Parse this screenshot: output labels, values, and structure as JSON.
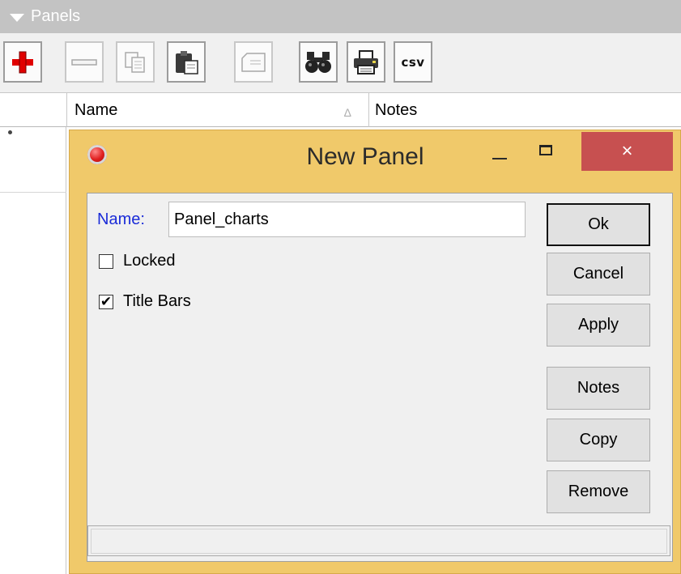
{
  "panels_header": {
    "title": "Panels"
  },
  "toolbar": {
    "buttons": [
      {
        "icon": "add-icon",
        "enabled": true
      },
      {
        "icon": "remove-icon",
        "enabled": false
      },
      {
        "icon": "copy-icon",
        "enabled": false
      },
      {
        "icon": "paste-icon",
        "enabled": true
      },
      {
        "icon": "comment-icon",
        "enabled": false
      },
      {
        "icon": "find-icon",
        "enabled": true
      },
      {
        "icon": "print-icon",
        "enabled": true
      },
      {
        "icon": "csv-icon",
        "label": "csv",
        "enabled": true
      }
    ]
  },
  "grid": {
    "columns": [
      {
        "label": "Name",
        "sorted": true
      },
      {
        "label": "Notes",
        "sorted": false
      }
    ],
    "sort_indicator": "∆"
  },
  "dialog": {
    "title": "New Panel",
    "close_glyph": "×",
    "name_label": "Name:",
    "name_value": "Panel_charts",
    "checkboxes": [
      {
        "label": "Locked",
        "checked": false
      },
      {
        "label": "Title Bars",
        "checked": true
      }
    ],
    "check_mark": "✔",
    "buttons": {
      "ok": "Ok",
      "cancel": "Cancel",
      "apply": "Apply",
      "notes": "Notes",
      "copy": "Copy",
      "remove": "Remove"
    }
  },
  "colors": {
    "dialog_frame": "#f0c96a",
    "close_button": "#c75050",
    "name_label": "#1a2bd8",
    "add_icon": "#e00000"
  }
}
